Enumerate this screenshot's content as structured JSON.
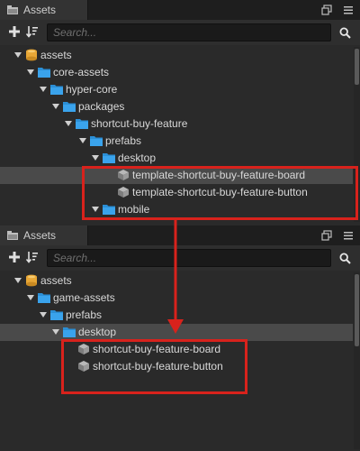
{
  "panels": [
    {
      "tab_label": "Assets",
      "search_placeholder": "Search...",
      "rows": [
        {
          "label": "assets",
          "type": "db",
          "expanded": true
        },
        {
          "label": "core-assets",
          "type": "folder",
          "expanded": true
        },
        {
          "label": "hyper-core",
          "type": "folder",
          "expanded": true
        },
        {
          "label": "packages",
          "type": "folder",
          "expanded": true
        },
        {
          "label": "shortcut-buy-feature",
          "type": "folder",
          "expanded": true
        },
        {
          "label": "prefabs",
          "type": "folder",
          "expanded": true
        },
        {
          "label": "desktop",
          "type": "folder",
          "expanded": true
        },
        {
          "label": "template-shortcut-buy-feature-board",
          "type": "prefab",
          "selected": true
        },
        {
          "label": "template-shortcut-buy-feature-button",
          "type": "prefab"
        },
        {
          "label": "mobile",
          "type": "folder",
          "expanded": true
        }
      ]
    },
    {
      "tab_label": "Assets",
      "search_placeholder": "Search...",
      "rows": [
        {
          "label": "assets",
          "type": "db",
          "expanded": true
        },
        {
          "label": "game-assets",
          "type": "folder",
          "expanded": true
        },
        {
          "label": "prefabs",
          "type": "folder",
          "expanded": true
        },
        {
          "label": "desktop",
          "type": "folder",
          "expanded": true,
          "selected": true
        },
        {
          "label": "shortcut-buy-feature-board",
          "type": "prefab"
        },
        {
          "label": "shortcut-buy-feature-button",
          "type": "prefab"
        }
      ]
    }
  ],
  "colors": {
    "highlight": "#d8221c",
    "folder": "#2b8fd6",
    "db": "#e8a736",
    "prefab": "#9a9a9a"
  },
  "icons": {
    "tab": "assets-tab-icon",
    "maximize": "maximize-icon",
    "menu": "menu-icon",
    "add": "plus-icon",
    "sort": "sort-icon",
    "search": "search-icon"
  }
}
